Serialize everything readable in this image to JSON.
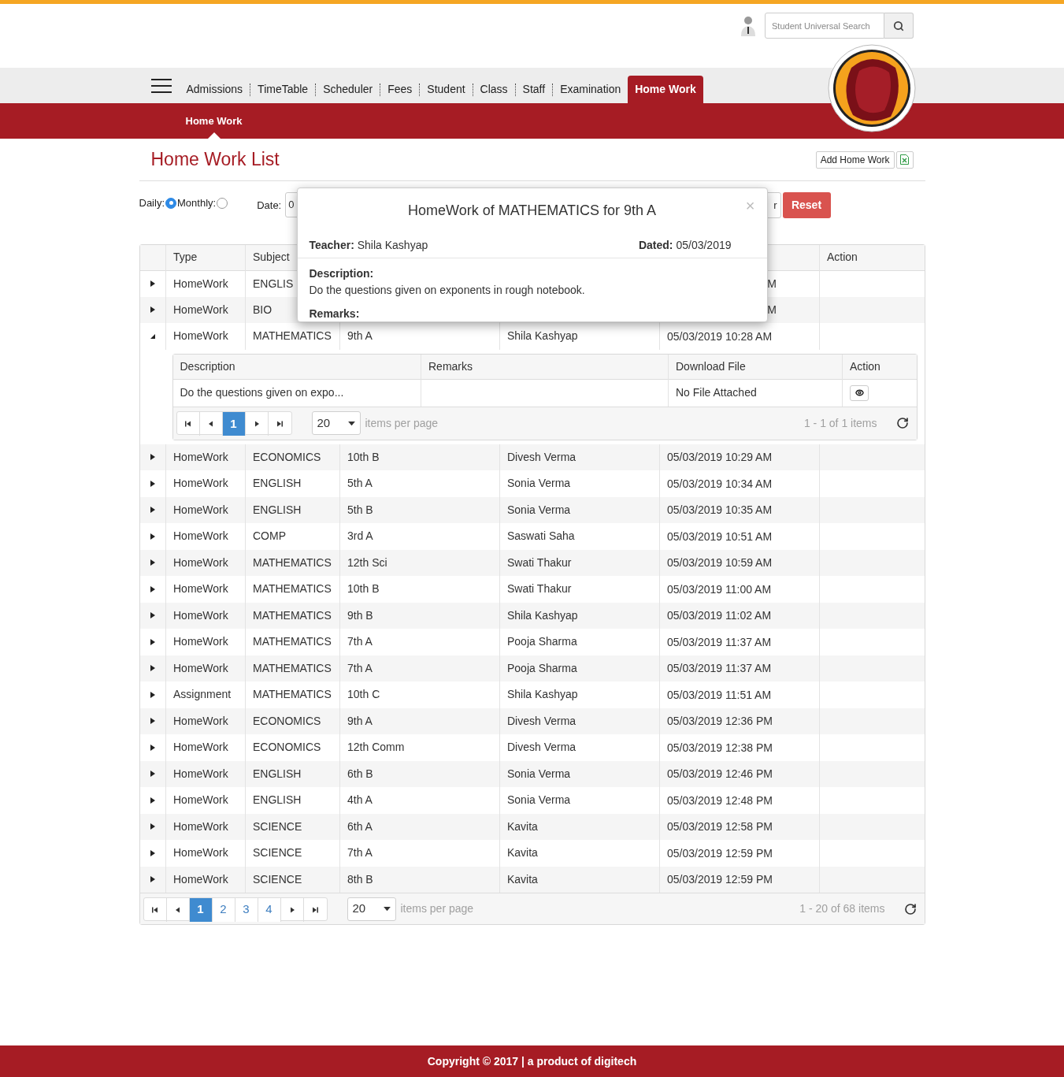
{
  "header": {
    "search": {
      "placeholder": "Student Universal Search"
    }
  },
  "nav": {
    "items": [
      {
        "label": "Admissions",
        "selected": false
      },
      {
        "label": "TimeTable",
        "selected": false
      },
      {
        "label": "Scheduler",
        "selected": false
      },
      {
        "label": "Fees",
        "selected": false
      },
      {
        "label": "Student",
        "selected": false
      },
      {
        "label": "Class",
        "selected": false
      },
      {
        "label": "Staff",
        "selected": false
      },
      {
        "label": "Examination",
        "selected": false
      },
      {
        "label": "Home Work",
        "selected": true
      }
    ]
  },
  "subnav": {
    "items": [
      {
        "label": "Home Work",
        "selected": true
      }
    ]
  },
  "page": {
    "title": "Home Work List",
    "add_button": "Add Home Work"
  },
  "filters": {
    "options": [
      {
        "label": "Daily:",
        "selected": true
      },
      {
        "label": "Monthly:",
        "selected": false
      }
    ],
    "date_label": "Date:",
    "date_value": "0",
    "apply_fragment": "r",
    "reset": "Reset"
  },
  "table": {
    "columns": [
      "Type",
      "Subject",
      "Action"
    ],
    "rows": [
      {
        "type": "HomeWork",
        "subject": "ENGLIS",
        "date": "M",
        "expanded": false
      },
      {
        "type": "HomeWork",
        "subject": "BIO",
        "date": "M",
        "expanded": false
      },
      {
        "type": "HomeWork",
        "subject": "MATHEMATICS",
        "class": "9th A",
        "teacher": "Shila Kashyap",
        "date": "05/03/2019 10:28 AM",
        "expanded": true
      },
      {
        "type": "HomeWork",
        "subject": "ECONOMICS",
        "class": "10th B",
        "teacher": "Divesh Verma",
        "date": "05/03/2019 10:29 AM",
        "expanded": false
      },
      {
        "type": "HomeWork",
        "subject": "ENGLISH",
        "class": "5th A",
        "teacher": "Sonia Verma",
        "date": "05/03/2019 10:34 AM",
        "expanded": false
      },
      {
        "type": "HomeWork",
        "subject": "ENGLISH",
        "class": "5th B",
        "teacher": "Sonia Verma",
        "date": "05/03/2019 10:35 AM",
        "expanded": false
      },
      {
        "type": "HomeWork",
        "subject": "COMP",
        "class": "3rd A",
        "teacher": "Saswati Saha",
        "date": "05/03/2019 10:51 AM",
        "expanded": false
      },
      {
        "type": "HomeWork",
        "subject": "MATHEMATICS",
        "class": "12th Sci",
        "teacher": "Swati Thakur",
        "date": "05/03/2019 10:59 AM",
        "expanded": false
      },
      {
        "type": "HomeWork",
        "subject": "MATHEMATICS",
        "class": "10th B",
        "teacher": "Swati Thakur",
        "date": "05/03/2019 11:00 AM",
        "expanded": false
      },
      {
        "type": "HomeWork",
        "subject": "MATHEMATICS",
        "class": "9th B",
        "teacher": "Shila Kashyap",
        "date": "05/03/2019 11:02 AM",
        "expanded": false
      },
      {
        "type": "HomeWork",
        "subject": "MATHEMATICS",
        "class": "7th A",
        "teacher": "Pooja Sharma",
        "date": "05/03/2019 11:37 AM",
        "expanded": false
      },
      {
        "type": "HomeWork",
        "subject": "MATHEMATICS",
        "class": "7th A",
        "teacher": "Pooja Sharma",
        "date": "05/03/2019 11:37 AM",
        "expanded": false
      },
      {
        "type": "Assignment",
        "subject": "MATHEMATICS",
        "class": "10th C",
        "teacher": "Shila Kashyap",
        "date": "05/03/2019 11:51 AM",
        "expanded": false
      },
      {
        "type": "HomeWork",
        "subject": "ECONOMICS",
        "class": "9th A",
        "teacher": "Divesh Verma",
        "date": "05/03/2019 12:36 PM",
        "expanded": false
      },
      {
        "type": "HomeWork",
        "subject": "ECONOMICS",
        "class": "12th Comm",
        "teacher": "Divesh Verma",
        "date": "05/03/2019 12:38 PM",
        "expanded": false
      },
      {
        "type": "HomeWork",
        "subject": "ENGLISH",
        "class": "6th B",
        "teacher": "Sonia Verma",
        "date": "05/03/2019 12:46 PM",
        "expanded": false
      },
      {
        "type": "HomeWork",
        "subject": "ENGLISH",
        "class": "4th A",
        "teacher": "Sonia Verma",
        "date": "05/03/2019 12:48 PM",
        "expanded": false
      },
      {
        "type": "HomeWork",
        "subject": "SCIENCE",
        "class": "6th A",
        "teacher": "Kavita",
        "date": "05/03/2019 12:58 PM",
        "expanded": false
      },
      {
        "type": "HomeWork",
        "subject": "SCIENCE",
        "class": "7th A",
        "teacher": "Kavita",
        "date": "05/03/2019 12:59 PM",
        "expanded": false
      },
      {
        "type": "HomeWork",
        "subject": "SCIENCE",
        "class": "8th B",
        "teacher": "Kavita",
        "date": "05/03/2019 12:59 PM",
        "expanded": false
      }
    ],
    "detail": {
      "columns": [
        "Description",
        "Remarks",
        "Download File",
        "Action"
      ],
      "rows": [
        {
          "description": "Do the questions given on expo...",
          "download": "No File Attached"
        }
      ],
      "pager": {
        "pages": [
          {
            "label": "1",
            "selected": true
          }
        ],
        "page_size": "20",
        "per_page_label": "items per page",
        "summary": "1 - 1 of 1 items"
      }
    },
    "pager": {
      "pages": [
        {
          "label": "1",
          "selected": true
        },
        {
          "label": "2",
          "selected": false
        },
        {
          "label": "3",
          "selected": false
        },
        {
          "label": "4",
          "selected": false
        }
      ],
      "page_size": "20",
      "per_page_label": "items per page",
      "summary": "1 - 20 of 68 items"
    }
  },
  "modal": {
    "title": "HomeWork of MATHEMATICS for 9th A",
    "close": "×",
    "teacher_label": "Teacher:",
    "teacher": "Shila Kashyap",
    "dated_label": "Dated:",
    "dated": "05/03/2019",
    "description_label": "Description:",
    "description": "Do the questions given on exponents in rough notebook.",
    "remarks_label": "Remarks:"
  },
  "footer": {
    "text": "Copyright © 2017 | a product of digitech"
  }
}
